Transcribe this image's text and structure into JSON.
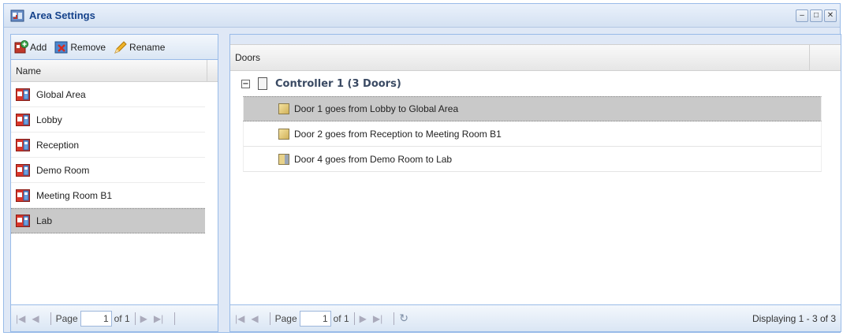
{
  "window": {
    "title": "Area Settings",
    "icon": "area-settings-icon"
  },
  "toolbar": {
    "add_label": "Add",
    "remove_label": "Remove",
    "rename_label": "Rename"
  },
  "areas": {
    "column_header": "Name",
    "items": [
      {
        "label": "Global Area"
      },
      {
        "label": "Lobby"
      },
      {
        "label": "Reception"
      },
      {
        "label": "Demo Room"
      },
      {
        "label": "Meeting Room B1"
      },
      {
        "label": "Lab",
        "selected": true
      }
    ],
    "pager": {
      "page_label": "Page",
      "page_value": "1",
      "of_label": "of 1"
    }
  },
  "doors": {
    "column_header": "Doors",
    "group_label": "Controller 1 (3 Doors)",
    "items": [
      {
        "label": "Door 1 goes from Lobby to Global Area",
        "selected": true
      },
      {
        "label": "Door 2 goes from Reception to Meeting Room B1"
      },
      {
        "label": "Door 4 goes from Demo Room to Lab"
      }
    ],
    "pager": {
      "page_label": "Page",
      "page_value": "1",
      "of_label": "of 1",
      "status": "Displaying 1 - 3 of 3"
    }
  }
}
